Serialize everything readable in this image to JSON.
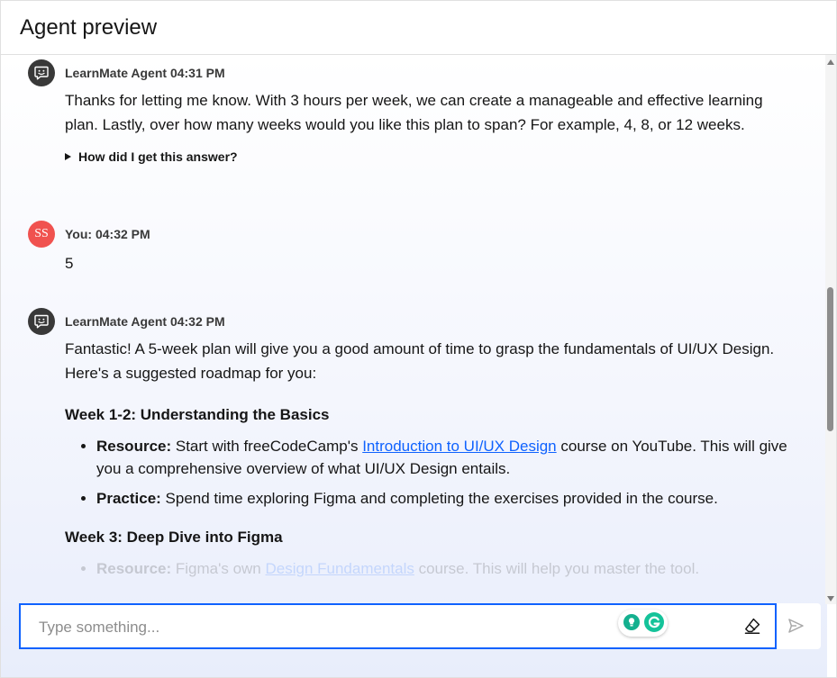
{
  "header": {
    "title": "Agent preview"
  },
  "messages": [
    {
      "sender": "LearnMate Agent 04:31 PM",
      "avatar_icon": "chat-bot-icon",
      "text": "Thanks for letting me know. With 3 hours per week, we can create a manageable and effective learning plan. Lastly, over how many weeks would you like this plan to span? For example, 4, 8, or 12 weeks.",
      "disclosure": "How did I get this answer?"
    },
    {
      "sender": "You: 04:32 PM",
      "avatar_initials": "SS",
      "text": "5"
    },
    {
      "sender": "LearnMate Agent 04:32 PM",
      "avatar_icon": "chat-bot-icon",
      "intro": "Fantastic! A 5-week plan will give you a good amount of time to grasp the fundamentals of UI/UX Design. Here's a suggested roadmap for you:",
      "weeks": [
        {
          "heading": "Week 1-2: Understanding the Basics",
          "points": [
            {
              "label": "Resource:",
              "before": " Start with freeCodeCamp's ",
              "link": "Introduction to UI/UX Design",
              "after": " course on YouTube. This will give you a comprehensive overview of what UI/UX Design entails."
            },
            {
              "label": "Practice:",
              "before": " Spend time exploring Figma and completing the exercises provided in the course."
            }
          ]
        },
        {
          "heading": "Week 3: Deep Dive into Figma",
          "points": [
            {
              "label": "Resource:",
              "before": " Figma's own ",
              "link": "Design Fundamentals",
              "after": " course. This will help you master the tool."
            }
          ]
        }
      ]
    }
  ],
  "input": {
    "placeholder": "Type something..."
  },
  "icons": {
    "eraser": "eraser-icon",
    "send": "send-icon",
    "extension_bulb": "lightbulb-icon",
    "extension_g": "grammarly-icon"
  },
  "colors": {
    "accent": "#0f62fe",
    "user_avatar": "#f0524f",
    "agent_avatar": "#393939"
  }
}
